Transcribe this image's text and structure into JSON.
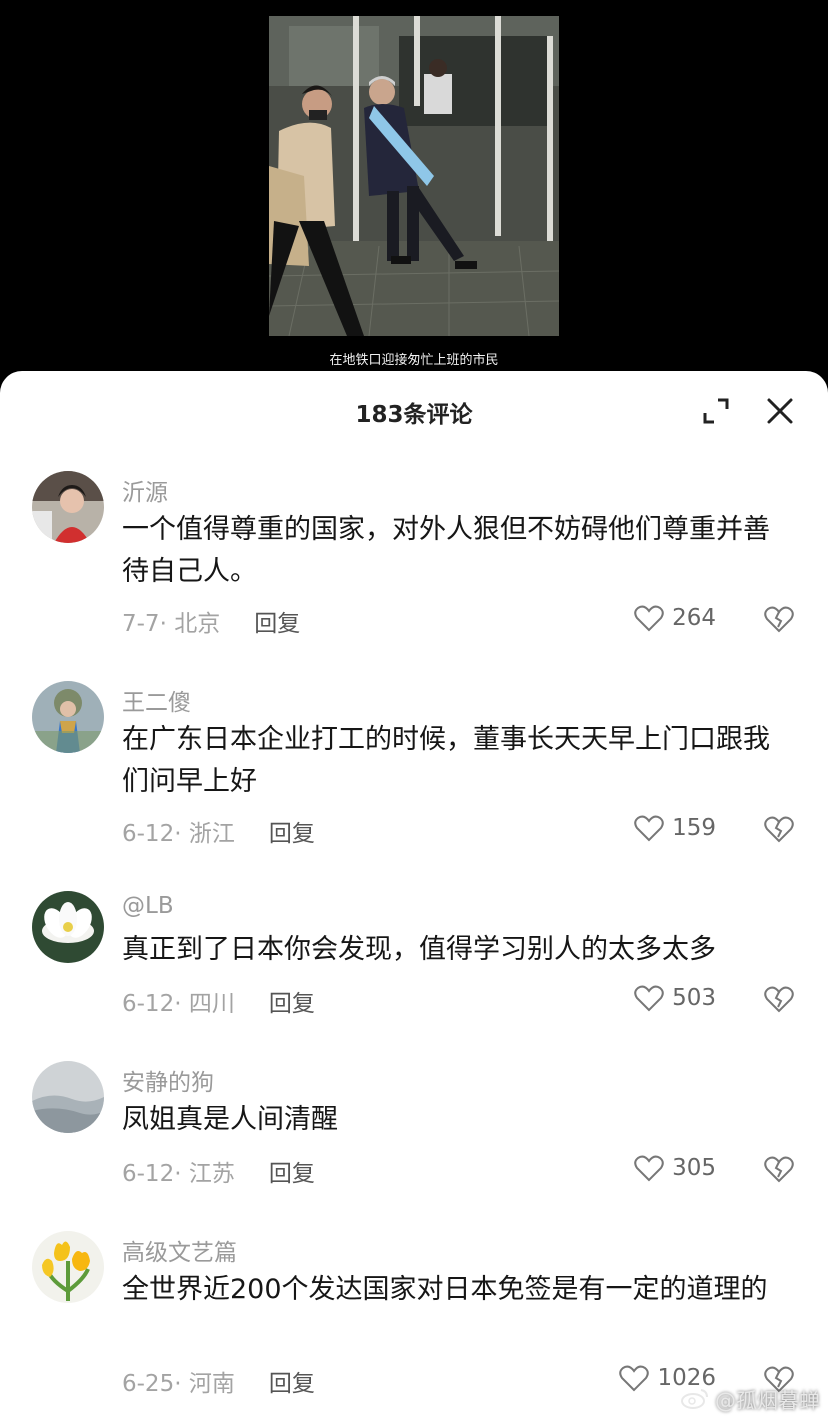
{
  "video": {
    "caption": "在地铁口迎接匆忙上班的市民"
  },
  "sheet": {
    "title": "183条评论"
  },
  "comments": [
    {
      "username": "沂源",
      "text": "一个值得尊重的国家，对外人狠但不妨碍他们尊重并善待自己人。",
      "date_location": "7-7· 北京",
      "reply_label": "回复",
      "likes": "264"
    },
    {
      "username": "王二傻",
      "text": "在广东日本企业打工的时候，董事长天天早上门口跟我们问早上好",
      "date_location": "6-12· 浙江",
      "reply_label": "回复",
      "likes": "159"
    },
    {
      "username": "@LB",
      "text": "真正到了日本你会发现，值得学习别人的太多太多",
      "date_location": "6-12· 四川",
      "reply_label": "回复",
      "likes": "503"
    },
    {
      "username": "安静的狗",
      "text": "凤姐真是人间清醒",
      "date_location": "6-12· 江苏",
      "reply_label": "回复",
      "likes": "305"
    },
    {
      "username": "高级文艺篇",
      "text": "全世界近200个发达国家对日本免签是有一定的道理的",
      "date_location": "6-25· 河南",
      "reply_label": "回复",
      "likes": "1026"
    }
  ],
  "watermark": {
    "text": "@孤烟暮蝉"
  },
  "icons": {
    "expand": "expand-icon",
    "close": "close-icon",
    "like": "heart-outline-icon",
    "dislike": "broken-heart-icon",
    "watermark": "weibo-logo-icon"
  }
}
